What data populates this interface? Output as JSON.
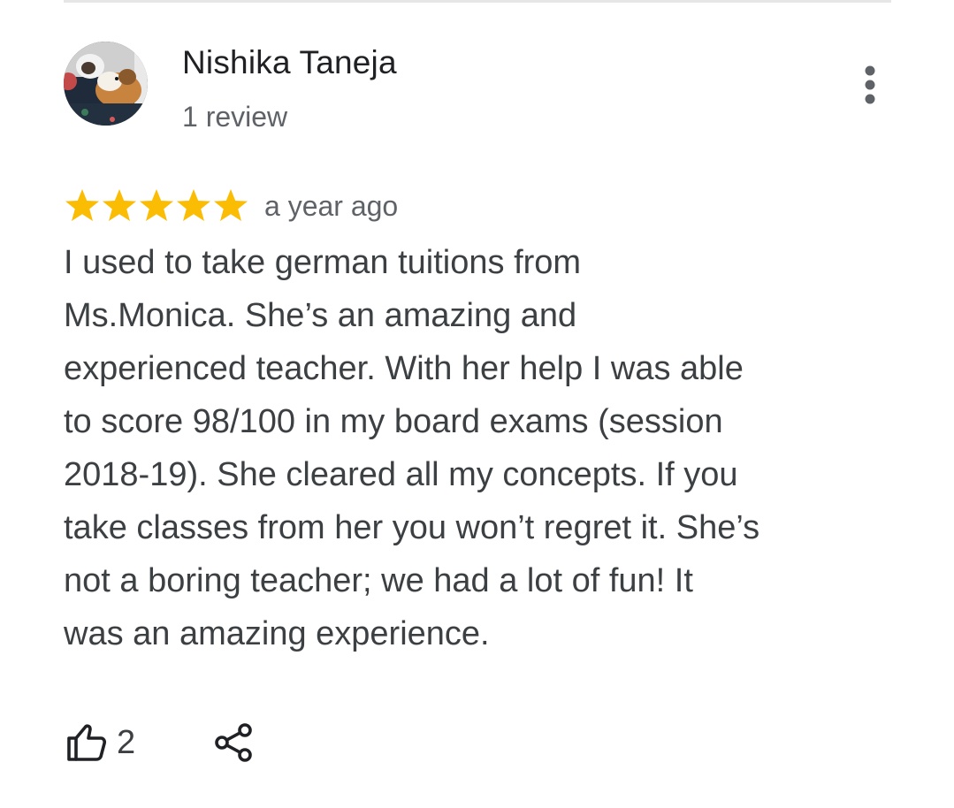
{
  "review": {
    "author": {
      "name": "Nishika Taneja",
      "review_count": "1 review",
      "avatar_icon": "profile-photo-guinea-pig"
    },
    "more_icon": "more-vert-icon",
    "rating": {
      "stars": 5,
      "max": 5,
      "star_color": "#fbbc04"
    },
    "timestamp": "a year ago",
    "text_lines": [
      "I used to take german tuitions from",
      "Ms.Monica. She’s an amazing and",
      "experienced teacher. With her help I was able",
      "to score 98/100 in my board exams (session",
      "2018-19). She cleared all my concepts. If you",
      "take classes from her you won’t regret it. She’s",
      "not a boring teacher; we had a lot of fun! It",
      "was an amazing experience."
    ],
    "actions": {
      "like_icon": "thumbs-up-icon",
      "like_count": "2",
      "share_icon": "share-icon"
    }
  },
  "colors": {
    "primary_text": "#202124",
    "secondary_text": "#5f6368",
    "body_text": "#3c4043",
    "divider": "#e6e6e6"
  }
}
